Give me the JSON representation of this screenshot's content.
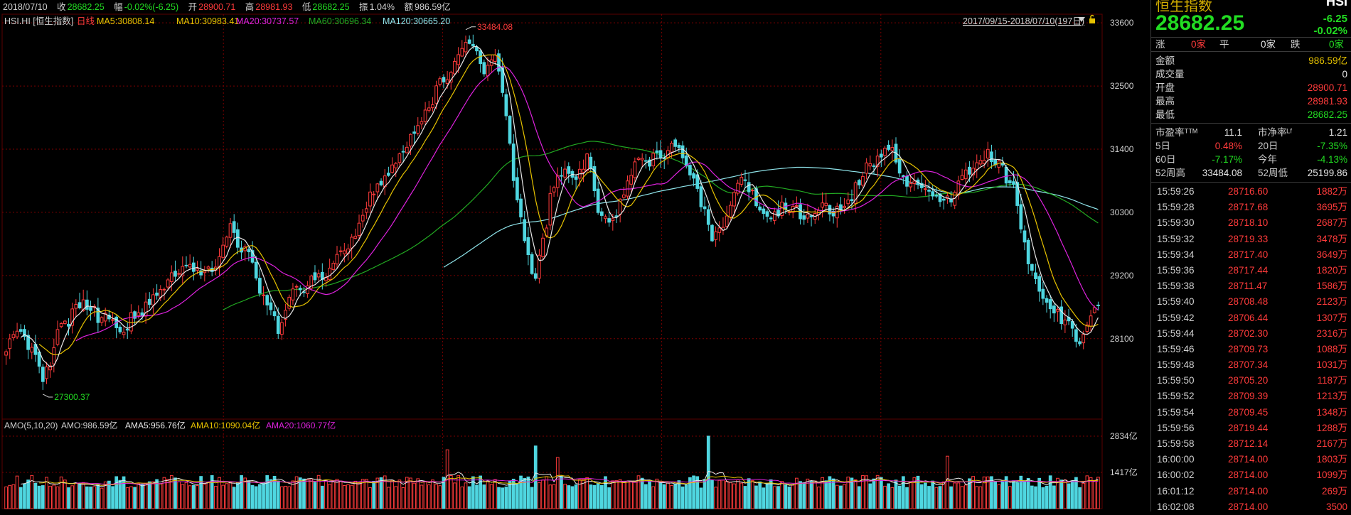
{
  "header": {
    "date": "2018/07/10",
    "close_label": "收",
    "close": "28682.25",
    "chg_label": "幅",
    "chg": "-0.02%(-6.25)",
    "open_label": "开",
    "open": "28900.71",
    "high_label": "高",
    "high": "28981.93",
    "low_label": "低",
    "low": "28682.25",
    "amp_label": "振",
    "amp": "1.04%",
    "amt_label": "额",
    "amt": "986.59亿"
  },
  "legend": {
    "symbol": "HSI.HI [恒生指数]",
    "period": "日线",
    "ma5": "MA5:30808.14",
    "ma10": "MA10:30983.41",
    "ma20": "MA20:30737.57",
    "ma60": "MA60:30696.34",
    "ma120": "MA120:30665.20",
    "range": "2017/09/15-2018/07/10(197日)"
  },
  "colors": {
    "up": "#ff3b3b",
    "down": "#4fd6e0",
    "ma5": "#e8e8e8",
    "ma10": "#e6c200",
    "ma20": "#dd22dd",
    "ma60": "#22aa22",
    "ma120": "#8fe4ea",
    "grid": "#7a0000"
  },
  "chart_data": [
    {
      "type": "candlestick",
      "title": "HSI.HI [恒生指数] 日线",
      "yticks": [
        28100,
        29200,
        30300,
        31400,
        32500,
        33600
      ],
      "ylim": [
        26700,
        33750
      ],
      "annotations": {
        "max_label": "33484.08",
        "min_label": "27300.37"
      },
      "ma_names": [
        "MA5",
        "MA10",
        "MA20",
        "MA60",
        "MA120"
      ],
      "keypoints": [
        [
          0,
          28000
        ],
        [
          4,
          28300
        ],
        [
          8,
          27700
        ],
        [
          10,
          27320
        ],
        [
          14,
          28150
        ],
        [
          20,
          28700
        ],
        [
          26,
          28450
        ],
        [
          32,
          28300
        ],
        [
          38,
          28700
        ],
        [
          44,
          29150
        ],
        [
          50,
          29400
        ],
        [
          56,
          29250
        ],
        [
          59,
          29850
        ],
        [
          61,
          30000
        ],
        [
          66,
          29500
        ],
        [
          70,
          28750
        ],
        [
          74,
          28300
        ],
        [
          78,
          28900
        ],
        [
          84,
          29100
        ],
        [
          88,
          29300
        ],
        [
          94,
          29800
        ],
        [
          100,
          30700
        ],
        [
          106,
          31200
        ],
        [
          112,
          31800
        ],
        [
          118,
          32500
        ],
        [
          124,
          33100
        ],
        [
          127,
          33300
        ],
        [
          130,
          32700
        ],
        [
          133,
          33050
        ],
        [
          136,
          32100
        ],
        [
          139,
          30400
        ],
        [
          142,
          29500
        ],
        [
          144,
          29100
        ],
        [
          148,
          30500
        ],
        [
          151,
          31000
        ],
        [
          155,
          30800
        ],
        [
          158,
          31300
        ],
        [
          161,
          30300
        ],
        [
          164,
          30000
        ],
        [
          168,
          30600
        ],
        [
          172,
          31300
        ],
        [
          176,
          31200
        ],
        [
          180,
          31400
        ],
        [
          184,
          31300
        ],
        [
          188,
          30700
        ],
        [
          192,
          29800
        ],
        [
          196,
          30200
        ],
        [
          199,
          30900
        ],
        [
          202,
          30700
        ],
        [
          206,
          30200
        ],
        [
          210,
          30350
        ],
        [
          214,
          30400
        ],
        [
          218,
          30200
        ],
        [
          222,
          30500
        ],
        [
          226,
          30300
        ],
        [
          230,
          30600
        ],
        [
          234,
          31100
        ],
        [
          238,
          31300
        ],
        [
          241,
          31300
        ],
        [
          244,
          30900
        ],
        [
          248,
          30800
        ],
        [
          252,
          30700
        ],
        [
          256,
          30500
        ],
        [
          260,
          30900
        ],
        [
          264,
          31200
        ],
        [
          268,
          31300
        ],
        [
          271,
          31000
        ],
        [
          274,
          30700
        ],
        [
          277,
          29700
        ],
        [
          280,
          29100
        ],
        [
          284,
          28700
        ],
        [
          288,
          28400
        ],
        [
          292,
          28100
        ],
        [
          295,
          28400
        ],
        [
          297,
          28682
        ]
      ],
      "volume": {
        "title": "AMO(5,10,20)",
        "amo": "AMO:986.59亿",
        "ama5": "AMA5:956.76亿",
        "ama10": "AMA10:1090.04亿",
        "ama20": "AMA20:1060.77亿",
        "yticks_labels": [
          "2834亿",
          "1417亿"
        ],
        "ytick_values": [
          2834,
          1417
        ],
        "ylim": [
          0,
          3000
        ],
        "spikes": [
          [
            144,
            2450
          ],
          [
            191,
            2834
          ],
          [
            256,
            2050
          ],
          [
            120,
            2300
          ],
          [
            150,
            2000
          ]
        ]
      }
    }
  ],
  "side": {
    "title": "恒生指数",
    "code": "HSI",
    "price": "28682.25",
    "chg": "-6.25",
    "chg_pct": "-0.02%",
    "adv": {
      "up_label": "涨",
      "up": "0家",
      "flat_label": "平",
      "flat": "0家",
      "down_label": "跌",
      "down": "0家"
    },
    "stats": [
      {
        "label": "金额",
        "value": "986.59亿",
        "cls": "yellow"
      },
      {
        "label": "成交量",
        "value": "0",
        "cls": "white"
      },
      {
        "label": "开盘",
        "value": "28900.71",
        "cls": "red"
      },
      {
        "label": "最高",
        "value": "28981.93",
        "cls": "red"
      },
      {
        "label": "最低",
        "value": "28682.25",
        "cls": "green"
      }
    ],
    "ratios": {
      "pe_label": "市盈率ᵀᵀᴹ",
      "pe": "11.1",
      "pb_label": "市净率ᴸᶠ",
      "pb": "1.21",
      "d5_label": "5日",
      "d5": "0.48%",
      "d20_label": "20日",
      "d20": "-7.35%",
      "d60_label": "60日",
      "d60": "-7.17%",
      "ytd_label": "今年",
      "ytd": "-4.13%",
      "h52_label": "52周高",
      "h52": "33484.08",
      "l52_label": "52周低",
      "l52": "25199.86"
    },
    "ticks": [
      {
        "time": "15:59:26",
        "price": "28716.60",
        "vol": "1882万"
      },
      {
        "time": "15:59:28",
        "price": "28717.68",
        "vol": "3695万"
      },
      {
        "time": "15:59:30",
        "price": "28718.10",
        "vol": "2687万"
      },
      {
        "time": "15:59:32",
        "price": "28719.33",
        "vol": "3478万"
      },
      {
        "time": "15:59:34",
        "price": "28717.40",
        "vol": "3649万"
      },
      {
        "time": "15:59:36",
        "price": "28717.44",
        "vol": "1820万"
      },
      {
        "time": "15:59:38",
        "price": "28711.47",
        "vol": "1586万"
      },
      {
        "time": "15:59:40",
        "price": "28708.48",
        "vol": "2123万"
      },
      {
        "time": "15:59:42",
        "price": "28706.44",
        "vol": "1307万"
      },
      {
        "time": "15:59:44",
        "price": "28702.30",
        "vol": "2316万"
      },
      {
        "time": "15:59:46",
        "price": "28709.73",
        "vol": "1088万"
      },
      {
        "time": "15:59:48",
        "price": "28707.34",
        "vol": "1031万"
      },
      {
        "time": "15:59:50",
        "price": "28705.20",
        "vol": "1187万"
      },
      {
        "time": "15:59:52",
        "price": "28709.39",
        "vol": "1213万"
      },
      {
        "time": "15:59:54",
        "price": "28709.45",
        "vol": "1348万"
      },
      {
        "time": "15:59:56",
        "price": "28719.44",
        "vol": "1288万"
      },
      {
        "time": "15:59:58",
        "price": "28712.14",
        "vol": "2167万"
      },
      {
        "time": "16:00:00",
        "price": "28714.00",
        "vol": "1803万"
      },
      {
        "time": "16:00:02",
        "price": "28714.00",
        "vol": "1099万"
      },
      {
        "time": "16:01:12",
        "price": "28714.00",
        "vol": "269万"
      },
      {
        "time": "16:02:08",
        "price": "28714.00",
        "vol": "3500"
      }
    ]
  }
}
